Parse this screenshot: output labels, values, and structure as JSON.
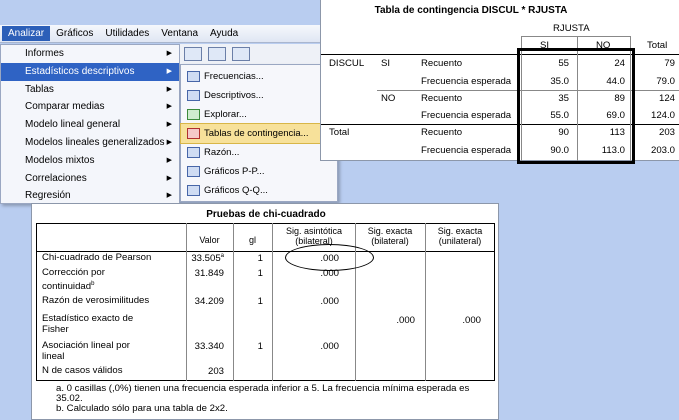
{
  "menubar": {
    "items": [
      "Analizar",
      "Gráficos",
      "Utilidades",
      "Ventana",
      "Ayuda"
    ]
  },
  "analyze_menu": {
    "items": [
      "Informes",
      "Estadísticos descriptivos",
      "Tablas",
      "Comparar medias",
      "Modelo lineal general",
      "Modelos lineales generalizados",
      "Modelos mixtos",
      "Correlaciones",
      "Regresión"
    ],
    "highlighted": "Estadísticos descriptivos"
  },
  "descriptives_submenu": {
    "items": [
      {
        "label": "Frecuencias...",
        "icon": "frequencies-icon"
      },
      {
        "label": "Descriptivos...",
        "icon": "descriptives-icon"
      },
      {
        "label": "Explorar...",
        "icon": "explore-icon"
      },
      {
        "label": "Tablas de contingencia...",
        "icon": "crosstabs-icon"
      },
      {
        "label": "Razón...",
        "icon": "ratio-icon"
      },
      {
        "label": "Gráficos P-P...",
        "icon": "pp-plot-icon"
      },
      {
        "label": "Gráficos Q-Q...",
        "icon": "qq-plot-icon"
      }
    ],
    "highlighted": "Tablas de contingencia..."
  },
  "contingency": {
    "title": "Tabla de contingencia DISCUL * RJUSTA",
    "col_var": "RJUSTA",
    "col_si": "SI",
    "col_no": "NO",
    "col_total": "Total",
    "row_var": "DISCUL",
    "rows": [
      {
        "group": "SI",
        "stat": "Recuento",
        "si": "55",
        "no": "24",
        "total": "79"
      },
      {
        "group": "",
        "stat": "Frecuencia esperada",
        "si": "35.0",
        "no": "44.0",
        "total": "79.0"
      },
      {
        "group": "NO",
        "stat": "Recuento",
        "si": "35",
        "no": "89",
        "total": "124"
      },
      {
        "group": "",
        "stat": "Frecuencia esperada",
        "si": "55.0",
        "no": "69.0",
        "total": "124.0"
      }
    ],
    "total_label": "Total",
    "total_rows": [
      {
        "stat": "Recuento",
        "si": "90",
        "no": "113",
        "total": "203"
      },
      {
        "stat": "Frecuencia esperada",
        "si": "90.0",
        "no": "113.0",
        "total": "203.0"
      }
    ]
  },
  "chi": {
    "title": "Pruebas de chi-cuadrado",
    "headers": {
      "valor": "Valor",
      "gl": "gl",
      "sig_asint": "Sig. asintótica (bilateral)",
      "sig_exacta_bi": "Sig. exacta (bilateral)",
      "sig_exacta_uni": "Sig. exacta (unilateral)"
    },
    "rows": [
      {
        "label": "Chi-cuadrado de Pearson",
        "valor": "33.505",
        "sup": "a",
        "gl": "1",
        "asint": ".000",
        "exbi": "",
        "exuni": ""
      },
      {
        "label": "Corrección por continuidad",
        "valor": "31.849",
        "sup": "b",
        "gl": "1",
        "asint": ".000",
        "exbi": "",
        "exuni": ""
      },
      {
        "label": "Razón de verosimilitudes",
        "valor": "34.209",
        "sup": "",
        "gl": "1",
        "asint": ".000",
        "exbi": "",
        "exuni": ""
      },
      {
        "label": "Estadístico exacto de Fisher",
        "valor": "",
        "sup": "",
        "gl": "",
        "asint": "",
        "exbi": ".000",
        "exuni": ".000"
      },
      {
        "label": "Asociación lineal por lineal",
        "valor": "33.340",
        "sup": "",
        "gl": "1",
        "asint": ".000",
        "exbi": "",
        "exuni": ""
      },
      {
        "label": "N de casos válidos",
        "valor": "203",
        "sup": "",
        "gl": "",
        "asint": "",
        "exbi": "",
        "exuni": ""
      }
    ],
    "footnote_a_line1": "a. 0 casillas (,0%) tienen una frecuencia esperada inferior a 5. La frecuencia mínima esperada es",
    "footnote_a_line2": "35.02.",
    "footnote_b": "b. Calculado sólo para una tabla de 2x2."
  }
}
